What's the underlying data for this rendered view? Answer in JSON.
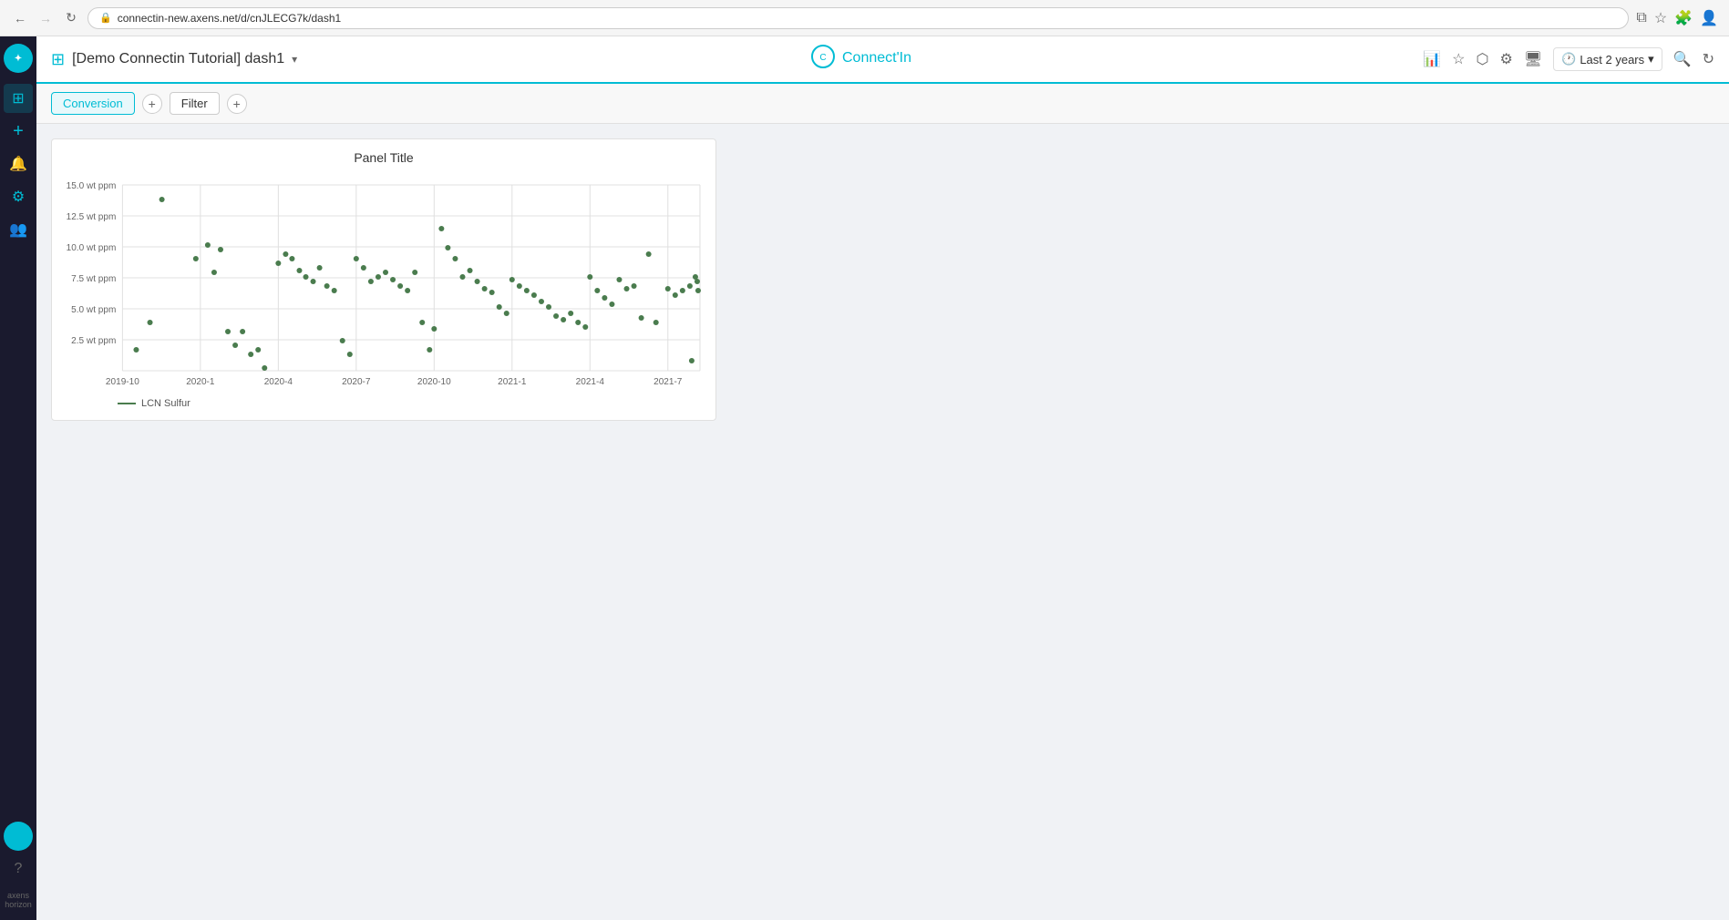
{
  "browser": {
    "url": "connectin-new.axens.net/d/cnJLECG7k/dash1",
    "back_disabled": false,
    "forward_disabled": true
  },
  "topbar": {
    "dashboard_title": "[Demo Connectin Tutorial] dash1",
    "logo": "Connect'In",
    "time_range_label": "Last 2 years",
    "time_range_icon": "🕐"
  },
  "toolbar": {
    "conversion_tab": "Conversion",
    "filter_tab": "Filter",
    "add_label": "+"
  },
  "panel": {
    "title": "Panel Title",
    "legend_label": "LCN Sulfur",
    "y_axis_labels": [
      "15.0 wt ppm",
      "12.5 wt ppm",
      "10.0 wt ppm",
      "7.5 wt ppm",
      "5.0 wt ppm",
      "2.5 wt ppm"
    ],
    "x_axis_labels": [
      "2019-10",
      "2020-1",
      "2020-4",
      "2020-7",
      "2020-10",
      "2021-1",
      "2021-4",
      "2021-7"
    ]
  },
  "sidebar": {
    "items": [
      {
        "name": "dashboard",
        "icon": "⊞"
      },
      {
        "name": "add",
        "icon": "+"
      },
      {
        "name": "bell",
        "icon": "🔔"
      },
      {
        "name": "settings",
        "icon": "⚙"
      },
      {
        "name": "users",
        "icon": "👥"
      }
    ],
    "brand": "axens\nhorizon"
  }
}
